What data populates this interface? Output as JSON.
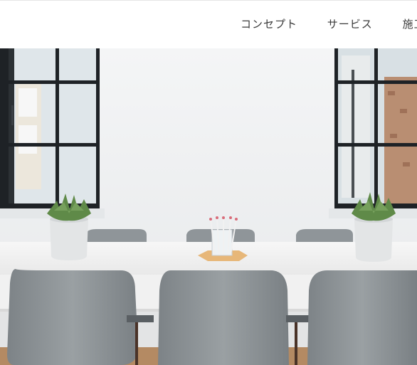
{
  "nav": {
    "items": [
      {
        "label": "コンセプト"
      },
      {
        "label": "サービス"
      },
      {
        "label": "施工"
      }
    ]
  },
  "hero": {
    "image_subject": "conference-room",
    "colors": {
      "wall": "#eef0f2",
      "window_frame": "#1e2226",
      "table": "#f3f3f3",
      "chair": "#8e9498",
      "plant": "#5f8a48",
      "pot": "#e3e5e6",
      "tray": "#e7b779",
      "floor": "#b48a63"
    }
  }
}
